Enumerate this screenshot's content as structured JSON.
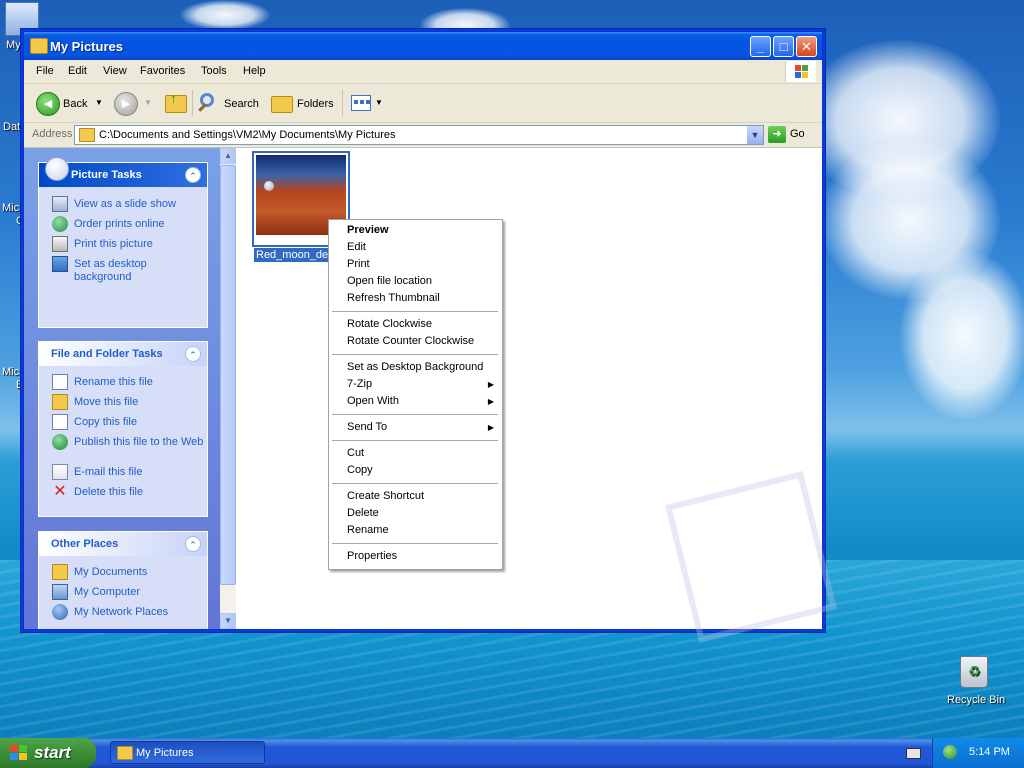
{
  "desktop": {
    "icons": [
      {
        "label": "My",
        "icon": "my-documents-icon"
      },
      {
        "label": "Dat",
        "icon": "data-icon"
      },
      {
        "label": "Micr",
        "icon": "microsoft-icon"
      },
      {
        "label": "C",
        "icon": "microsoft-icon"
      },
      {
        "label": "Micr",
        "icon": "microsoft-icon"
      },
      {
        "label": "B",
        "icon": "microsoft-icon"
      },
      {
        "label": "Recycle Bin",
        "icon": "recycle-bin-icon"
      }
    ]
  },
  "window": {
    "title": "My Pictures",
    "menu": [
      "File",
      "Edit",
      "View",
      "Favorites",
      "Tools",
      "Help"
    ],
    "toolbar": {
      "back": "Back",
      "search": "Search",
      "folders": "Folders"
    },
    "address": {
      "label": "Address",
      "value": "C:\\Documents and Settings\\VM2\\My Documents\\My Pictures",
      "go": "Go"
    }
  },
  "taskpane": {
    "picture_tasks": {
      "title": "Picture Tasks",
      "items": [
        "View as a slide show",
        "Order prints online",
        "Print this picture",
        "Set as desktop background"
      ]
    },
    "file_tasks": {
      "title": "File and Folder Tasks",
      "items": [
        "Rename this file",
        "Move this file",
        "Copy this file",
        "Publish this file to the Web",
        "E-mail this file",
        "Delete this file"
      ]
    },
    "other_places": {
      "title": "Other Places",
      "items": [
        "My Documents",
        "My Computer",
        "My Network Places"
      ]
    }
  },
  "content": {
    "file_label": "Red_moon_des"
  },
  "context_menu": {
    "items": [
      "Preview",
      "Edit",
      "Print",
      "Open file location",
      "Refresh Thumbnail",
      "Rotate Clockwise",
      "Rotate Counter Clockwise",
      "Set as Desktop Background",
      "7-Zip",
      "Open With",
      "Send To",
      "Cut",
      "Copy",
      "Create Shortcut",
      "Delete",
      "Rename",
      "Properties"
    ]
  },
  "taskbar": {
    "start": "start",
    "task": "My Pictures",
    "clock": "5:14 PM"
  },
  "colors": {
    "accent": "#0a5ce6",
    "selection": "#316ac5",
    "link": "#215dc6"
  }
}
